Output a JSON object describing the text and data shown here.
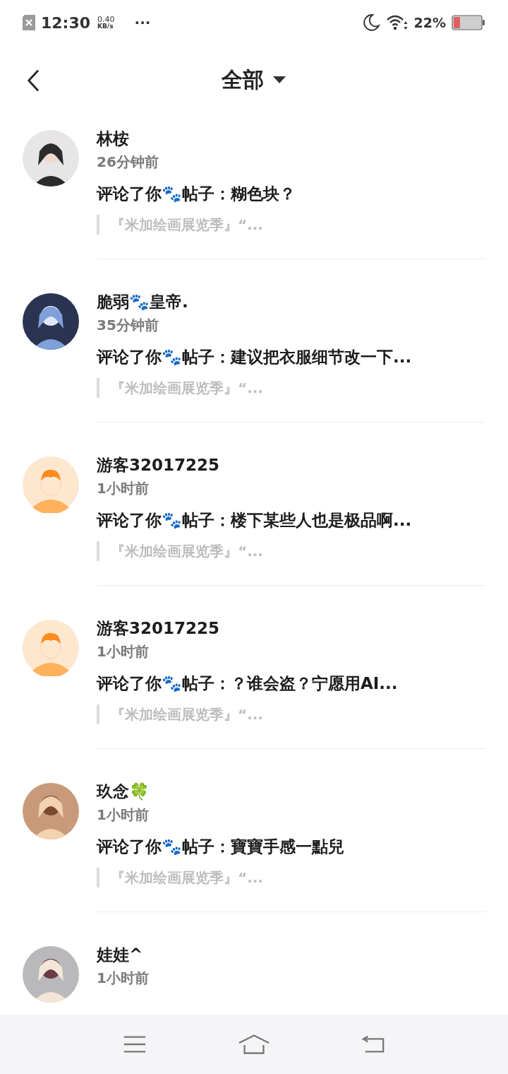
{
  "status_bar": {
    "time": "12:30",
    "speed_value": "0.40",
    "speed_unit": "KB/s",
    "more": "···",
    "battery": "22%"
  },
  "header": {
    "title": "全部"
  },
  "notifications": [
    {
      "kind": "picture",
      "name": "林桉",
      "time": "26分钟前",
      "comment": "评论了你🐾帖子：糊色块？",
      "quote": "『米加绘画展览季』“..."
    },
    {
      "kind": "picture",
      "name": "脆弱🐾皇帝.",
      "time": "35分钟前",
      "comment": "评论了你🐾帖子：建议把衣服细节改一下...",
      "quote": "『米加绘画展览季』“..."
    },
    {
      "kind": "guest",
      "name": "游客32017225",
      "time": "1小时前",
      "comment": "评论了你🐾帖子：楼下某些人也是极品啊...",
      "quote": "『米加绘画展览季』“..."
    },
    {
      "kind": "guest",
      "name": "游客32017225",
      "time": "1小时前",
      "comment": "评论了你🐾帖子：？谁会盗？宁愿用AI...",
      "quote": "『米加绘画展览季』“..."
    },
    {
      "kind": "picture",
      "name": "玖念🍀",
      "time": "1小时前",
      "comment": "评论了你🐾帖子：寶寶手感一點兒",
      "quote": "『米加绘画展览季』“..."
    },
    {
      "kind": "picture",
      "name": "娃娃^",
      "time": "1小时前"
    }
  ]
}
